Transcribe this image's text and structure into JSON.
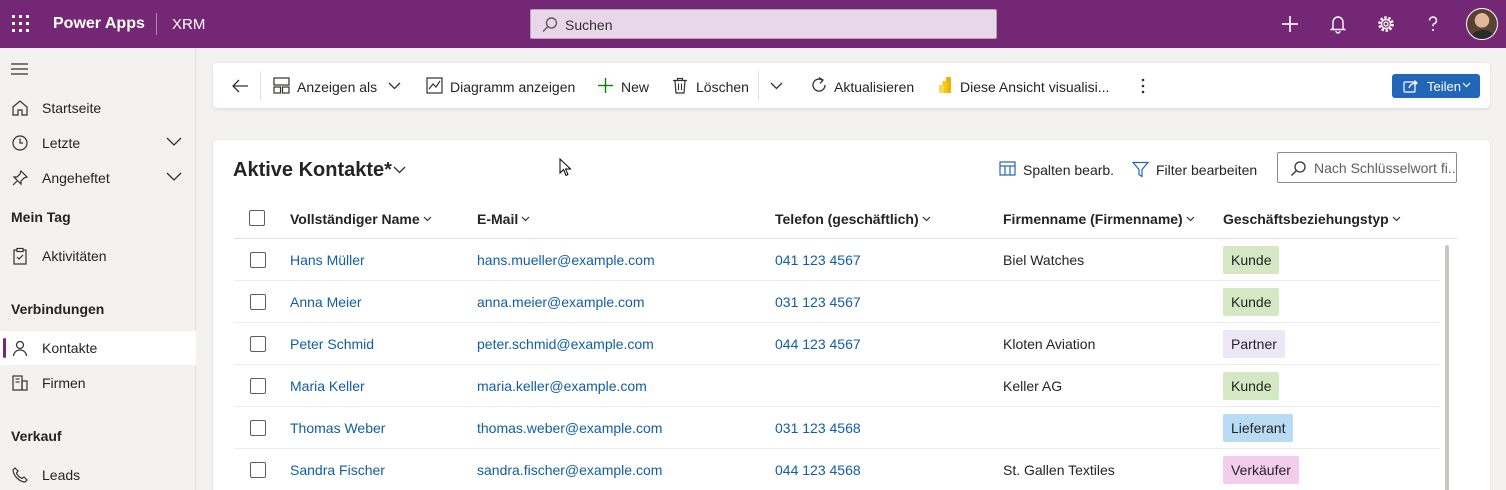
{
  "topbar": {
    "app_name": "Power Apps",
    "environment": "XRM",
    "search_placeholder": "Suchen"
  },
  "sidebar": {
    "items_top": [
      {
        "label": "Startseite",
        "icon": "home-icon"
      },
      {
        "label": "Letzte",
        "icon": "clock-icon",
        "expandable": true
      },
      {
        "label": "Angeheftet",
        "icon": "pin-icon",
        "expandable": true
      }
    ],
    "sections": [
      {
        "heading": "Mein Tag",
        "items": [
          {
            "label": "Aktivitäten",
            "icon": "clipboard-icon"
          }
        ]
      },
      {
        "heading": "Verbindungen",
        "items": [
          {
            "label": "Kontakte",
            "icon": "person-icon",
            "active": true
          },
          {
            "label": "Firmen",
            "icon": "building-icon"
          }
        ]
      },
      {
        "heading": "Verkauf",
        "items": [
          {
            "label": "Leads",
            "icon": "phone-icon"
          }
        ]
      }
    ]
  },
  "commandbar": {
    "show_as": "Anzeigen als",
    "show_chart": "Diagramm anzeigen",
    "new": "New",
    "delete": "Löschen",
    "refresh": "Aktualisieren",
    "visualize": "Diese Ansicht visualisi...",
    "share": "Teilen"
  },
  "view": {
    "title": "Aktive Kontakte*",
    "edit_columns": "Spalten bearb.",
    "edit_filters": "Filter bearbeiten",
    "keyword_placeholder": "Nach Schlüsselwort fi..."
  },
  "table": {
    "columns": [
      "Vollständiger Name",
      "E-Mail",
      "Telefon (geschäftlich)",
      "Firmenname (Firmenname)",
      "Geschäftsbeziehungstyp"
    ],
    "rows": [
      {
        "name": "Hans Müller",
        "email": "hans.mueller@example.com",
        "phone": "041 123 4567",
        "company": "Biel Watches",
        "type": "Kunde",
        "type_color": "#d5e8c4"
      },
      {
        "name": "Anna Meier",
        "email": "anna.meier@example.com",
        "phone": "031 123 4567",
        "company": "",
        "type": "Kunde",
        "type_color": "#d5e8c4"
      },
      {
        "name": "Peter Schmid",
        "email": "peter.schmid@example.com",
        "phone": "044 123 4567",
        "company": "Kloten Aviation",
        "type": "Partner",
        "type_color": "#ece6f7"
      },
      {
        "name": "Maria Keller",
        "email": "maria.keller@example.com",
        "phone": "",
        "company": "Keller AG",
        "type": "Kunde",
        "type_color": "#d5e8c4"
      },
      {
        "name": "Thomas Weber",
        "email": "thomas.weber@example.com",
        "phone": "031 123 4568",
        "company": "",
        "type": "Lieferant",
        "type_color": "#b8dcf4"
      },
      {
        "name": "Sandra Fischer",
        "email": "sandra.fischer@example.com",
        "phone": "044 123 4568",
        "company": "St. Gallen Textiles",
        "type": "Verkäufer",
        "type_color": "#f2cdec"
      }
    ]
  },
  "colors": {
    "brand": "#742774",
    "link": "#115ea3",
    "primary_button": "#2266b8"
  }
}
